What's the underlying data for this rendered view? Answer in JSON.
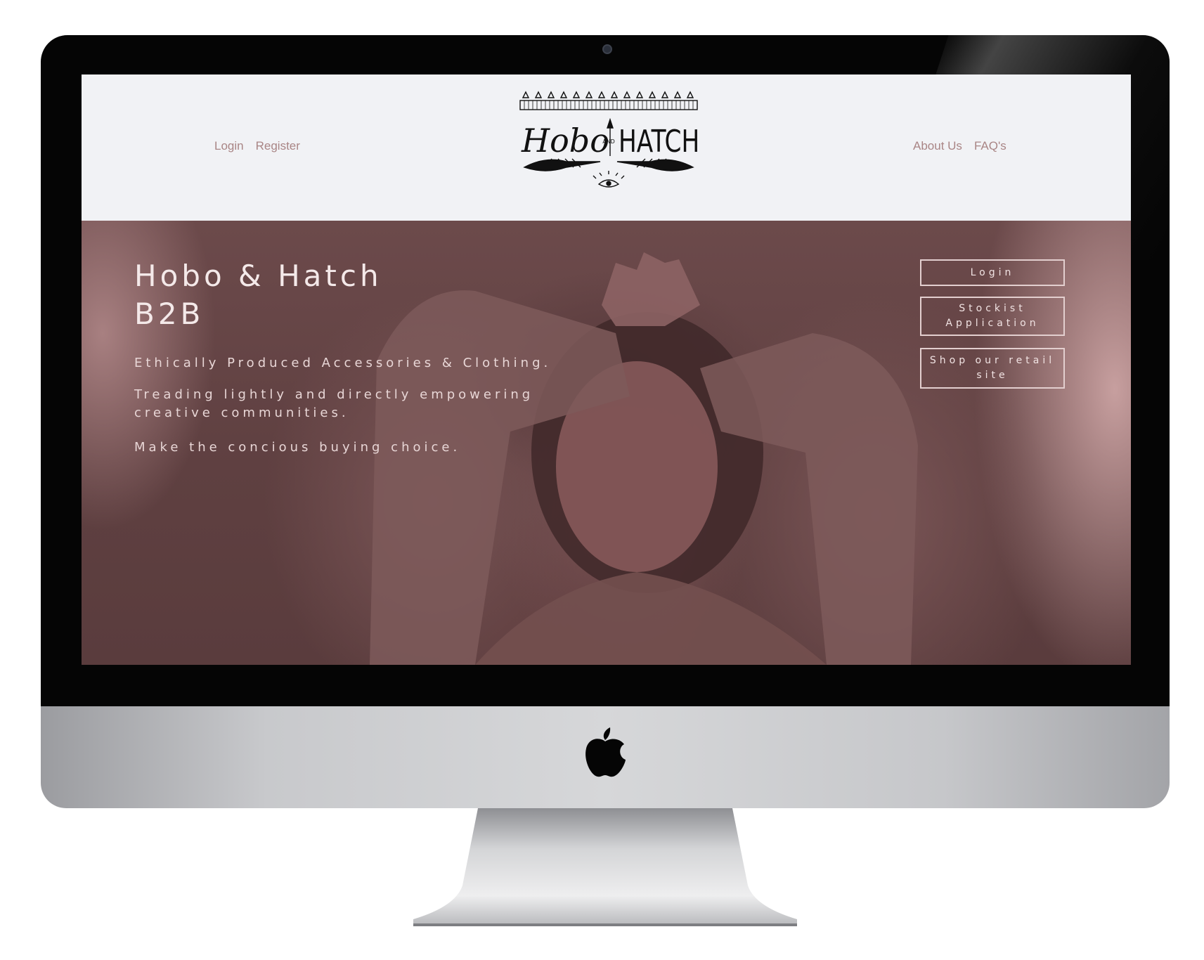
{
  "header": {
    "nav_left": [
      {
        "label": "Login"
      },
      {
        "label": "Register"
      }
    ],
    "nav_right": [
      {
        "label": "About Us"
      },
      {
        "label": "FAQ's"
      }
    ],
    "logo": {
      "top_word": "Hobo",
      "connector": "AND",
      "brand_word": "HATCH"
    }
  },
  "hero": {
    "title_line1": "Hobo & Hatch",
    "title_line2": "B2B",
    "tagline1": "Ethically Produced Accessories & Clothing.",
    "tagline2": "Treading lightly and directly empowering creative communities.",
    "tagline3": "Make the concious buying choice.",
    "buttons": {
      "login": "Login",
      "stockist": "Stockist Application",
      "shop": "Shop our retail site"
    }
  },
  "colors": {
    "header_bg": "#f1f2f5",
    "nav_text": "#a98585",
    "hero_tint": "#5f4041",
    "hero_text": "#f4e9e9"
  },
  "device": {
    "frame": "iMac",
    "icon": "apple-logo-icon"
  }
}
